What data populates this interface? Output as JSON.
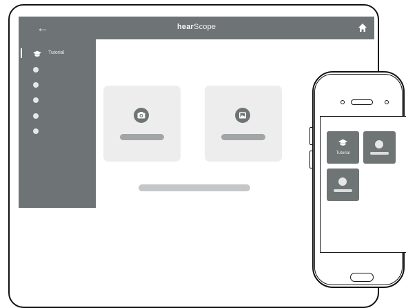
{
  "app": {
    "logo_bold": "hear",
    "logo_rest": "Scope"
  },
  "sidebar": {
    "active_item_label": "Tutorial",
    "placeholder_items": 5
  },
  "content": {
    "cards": [
      {
        "icon": "camera-icon"
      },
      {
        "icon": "media-icon"
      }
    ]
  },
  "phone": {
    "tiles": [
      {
        "label": "Tutorial",
        "icon": "graduation-cap-icon"
      },
      {
        "label": "",
        "icon": "placeholder-dot"
      },
      {
        "label": "",
        "icon": "placeholder-dot"
      }
    ]
  },
  "colors": {
    "header": "#6e7375",
    "sidebar": "#6e7375",
    "card": "#ededed",
    "tile": "#6f7475"
  }
}
